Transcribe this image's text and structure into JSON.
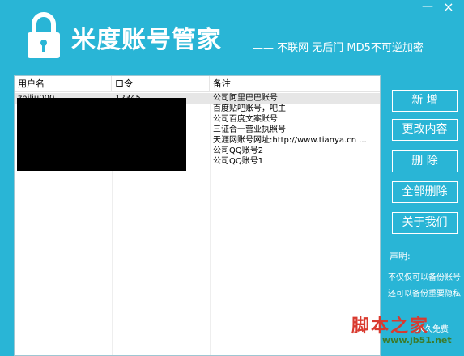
{
  "header": {
    "title": "米度账号管家",
    "slogan": "—— 不联网  无后门  MD5不可逆加密",
    "min_label": "—",
    "close_label": "×"
  },
  "table": {
    "columns": [
      "用户名",
      "口令",
      "备注"
    ],
    "rows": [
      {
        "user": "zhiliu000",
        "pass": "12345",
        "note": "公司阿里巴巴账号"
      },
      {
        "user": "",
        "pass": "",
        "note": "百度贴吧账号，吧主"
      },
      {
        "user": "",
        "pass": "",
        "note": "公司百度文案账号"
      },
      {
        "user": "",
        "pass": "",
        "note": "三证合一营业执照号"
      },
      {
        "user": "",
        "pass": "",
        "note": "天涯网账号网址:http://www.tianya.cn ..."
      },
      {
        "user": "",
        "pass": "",
        "note": "公司QQ账号2"
      },
      {
        "user": "",
        "pass": "",
        "note": "公司QQ账号1"
      }
    ]
  },
  "buttons": {
    "add": "新  增",
    "edit": "更改内容",
    "delete": "删  除",
    "delete_all": "全部删除",
    "about": "关于我们"
  },
  "notice": {
    "title": "声明:",
    "line1": "不仅仅可以备份账号",
    "line2": "还可以备份重要隐私",
    "line3": "永久免费"
  },
  "watermark": {
    "text": "脚本之家",
    "url": "www.jb51.net"
  }
}
